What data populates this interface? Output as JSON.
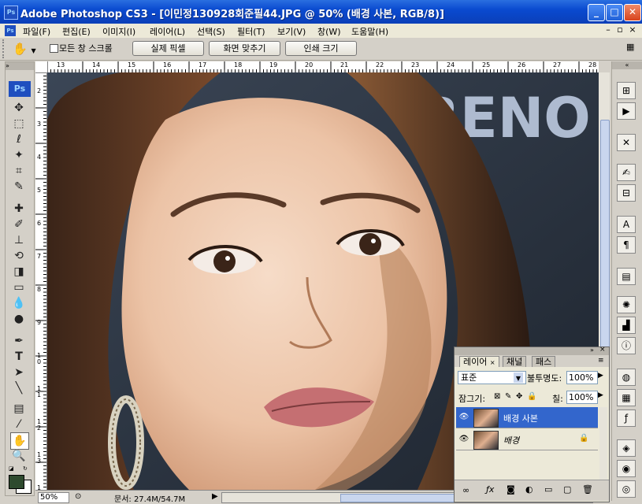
{
  "window": {
    "title": "Adobe Photoshop CS3 - [이민정130928회준필44.JPG @ 50% (배경 사본, RGB/8)]",
    "app_badge": "Ps",
    "controls": {
      "minimize": "_",
      "maximize": "□",
      "close": "✕"
    }
  },
  "menu": {
    "items": [
      "파일(F)",
      "편집(E)",
      "이미지(I)",
      "레이어(L)",
      "선택(S)",
      "필터(T)",
      "보기(V)",
      "창(W)",
      "도움말(H)"
    ],
    "doc_controls": [
      "–",
      "▫",
      "×"
    ]
  },
  "options_bar": {
    "tool_icon": "hand-tool-icon",
    "scroll_all_label": "모든 창 스크롤",
    "buttons": [
      "실제 픽셀",
      "화면 맞추기",
      "인쇄 크기"
    ]
  },
  "tools": {
    "badge": "Ps",
    "items": [
      "move",
      "marquee",
      "lasso",
      "magic-wand",
      "crop",
      "slice",
      "healing",
      "brush",
      "stamp",
      "history-brush",
      "eraser",
      "gradient",
      "blur",
      "dodge",
      "pen",
      "type",
      "path-select",
      "line",
      "notes",
      "eyedropper",
      "hand",
      "zoom"
    ],
    "foreground_color": "#2e4a2e",
    "background_color": "#ffffff"
  },
  "rulers": {
    "top": [
      "13",
      "14",
      "15",
      "16",
      "17",
      "18",
      "19",
      "20",
      "21",
      "22",
      "23",
      "24",
      "25",
      "26",
      "27",
      "28"
    ],
    "left": [
      "2",
      "3",
      "4",
      "5",
      "6",
      "7",
      "8",
      "9",
      "1\n0",
      "1\n1",
      "1\n2",
      "1\n3",
      "1\n4"
    ]
  },
  "canvas": {
    "backdrop_text": "RENO"
  },
  "status": {
    "zoom": "50%",
    "doc_info": "문서: 27.4M/54.7M"
  },
  "layers_panel": {
    "tabs": [
      "레이어",
      "채널",
      "패스"
    ],
    "blend_mode": "표준",
    "opacity_label": "불투명도:",
    "opacity_value": "100%",
    "lock_label": "잠그기:",
    "fill_label": "칠:",
    "fill_value": "100%",
    "layers": [
      {
        "name": "배경 사본",
        "selected": true,
        "locked": false
      },
      {
        "name": "배경",
        "selected": false,
        "locked": true
      }
    ],
    "footer_icons": [
      "link",
      "fx",
      "mask",
      "adjustment",
      "group",
      "new-layer",
      "trash"
    ]
  },
  "colors": {
    "titlebar": "#0a4ad0",
    "selection": "#3366cc",
    "chrome": "#d4d0c8"
  }
}
